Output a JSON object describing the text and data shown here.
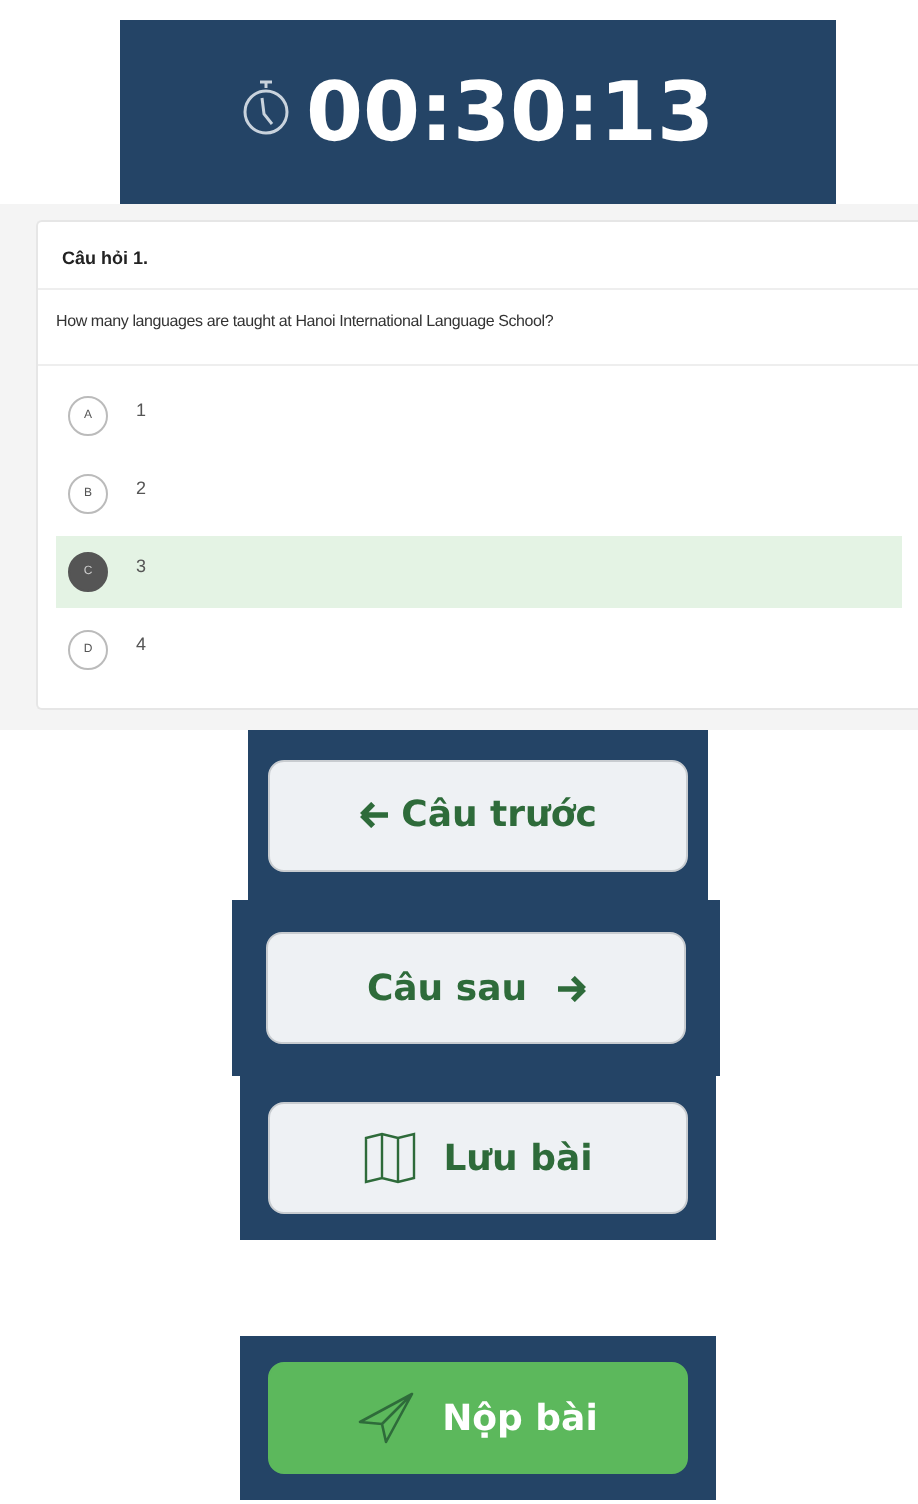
{
  "timer": {
    "time": "00:30:13"
  },
  "question": {
    "title": "Câu hỏi 1.",
    "text": "How many languages are taught at Hanoi International Language School?",
    "options": [
      {
        "letter": "A",
        "text": "1",
        "selected": false
      },
      {
        "letter": "B",
        "text": "2",
        "selected": false
      },
      {
        "letter": "C",
        "text": "3",
        "selected": true
      },
      {
        "letter": "D",
        "text": "4",
        "selected": false
      }
    ]
  },
  "buttons": [
    {
      "label": "Câu trước",
      "kind": "prev"
    },
    {
      "label": "Câu sau",
      "kind": "next"
    },
    {
      "label": "Lưu bài",
      "kind": "save"
    },
    {
      "label": "Nộp bài",
      "kind": "submit"
    }
  ]
}
